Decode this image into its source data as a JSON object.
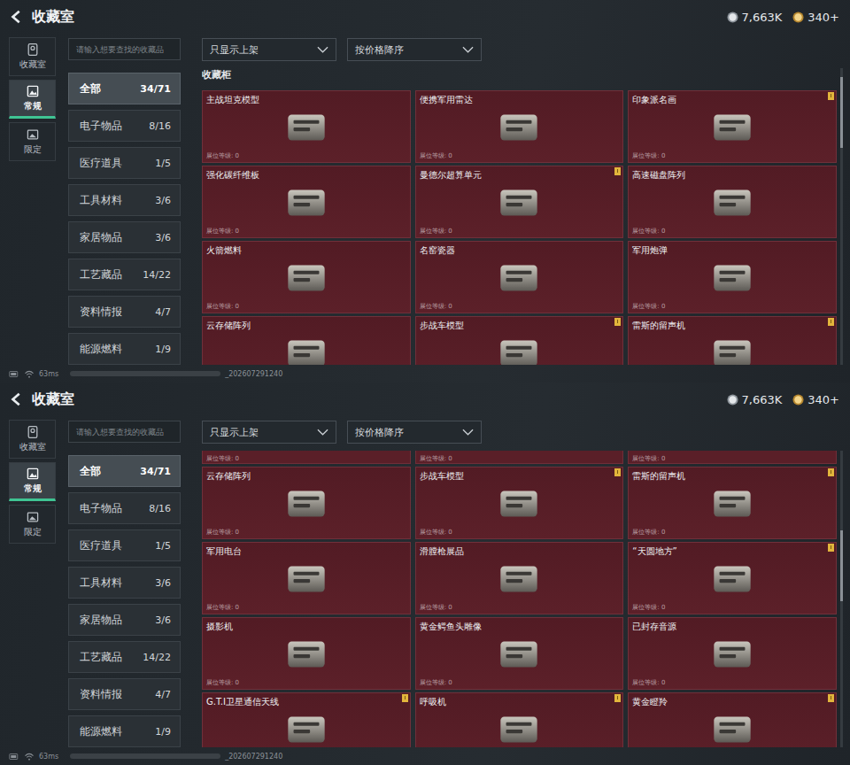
{
  "screens": [
    {
      "title": "收藏室",
      "currency": [
        {
          "amount": "7,663K",
          "kind": "silver"
        },
        {
          "amount": "340+",
          "kind": "gold"
        }
      ],
      "rail": [
        {
          "label": "收藏室",
          "selected": false
        },
        {
          "label": "常规",
          "selected": true
        },
        {
          "label": "限定",
          "selected": false
        }
      ],
      "search": {
        "placeholder": "请输入想要查找的收藏品"
      },
      "categories": [
        {
          "name": "全部",
          "count": "34/71",
          "selected": true
        },
        {
          "name": "电子物品",
          "count": "8/16",
          "selected": false
        },
        {
          "name": "医疗道具",
          "count": "1/5",
          "selected": false
        },
        {
          "name": "工具材料",
          "count": "3/6",
          "selected": false
        },
        {
          "name": "家居物品",
          "count": "3/6",
          "selected": false
        },
        {
          "name": "工艺藏品",
          "count": "14/22",
          "selected": false
        },
        {
          "name": "资料情报",
          "count": "4/7",
          "selected": false
        },
        {
          "name": "能源燃料",
          "count": "1/9",
          "selected": false
        }
      ],
      "filters": [
        {
          "label": "只显示上架"
        },
        {
          "label": "按价格降序"
        }
      ],
      "section_title": "收藏柜",
      "partial_row": [],
      "cards": [
        {
          "name": "主战坦克模型",
          "level_text": "展位等级: 0",
          "badge": false
        },
        {
          "name": "便携军用雷达",
          "level_text": "展位等级: 0",
          "badge": false
        },
        {
          "name": "印象派名画",
          "level_text": "展位等级: 0",
          "badge": true
        },
        {
          "name": "强化碳纤维板",
          "level_text": "展位等级: 0",
          "badge": false
        },
        {
          "name": "曼德尔超算单元",
          "level_text": "展位等级: 0",
          "badge": true
        },
        {
          "name": "高速磁盘阵列",
          "level_text": "展位等级: 0",
          "badge": false
        },
        {
          "name": "火箭燃料",
          "level_text": "展位等级: 0",
          "badge": false
        },
        {
          "name": "名窑瓷器",
          "level_text": "展位等级: 0",
          "badge": false
        },
        {
          "name": "军用炮弹",
          "level_text": "展位等级: 0",
          "badge": false
        },
        {
          "name": "云存储阵列",
          "badge": false
        },
        {
          "name": "步战车模型",
          "badge": true
        },
        {
          "name": "雷斯的留声机",
          "badge": true
        }
      ],
      "status": {
        "ping": "63ms",
        "build": "_202607291240"
      }
    },
    {
      "title": "收藏室",
      "currency": [
        {
          "amount": "7,663K",
          "kind": "silver"
        },
        {
          "amount": "340+",
          "kind": "gold"
        }
      ],
      "rail": [
        {
          "label": "收藏室",
          "selected": false
        },
        {
          "label": "常规",
          "selected": true
        },
        {
          "label": "限定",
          "selected": false
        }
      ],
      "search": {
        "placeholder": "请输入想要查找的收藏品"
      },
      "categories": [
        {
          "name": "全部",
          "count": "34/71",
          "selected": true
        },
        {
          "name": "电子物品",
          "count": "8/16",
          "selected": false
        },
        {
          "name": "医疗道具",
          "count": "1/5",
          "selected": false
        },
        {
          "name": "工具材料",
          "count": "3/6",
          "selected": false
        },
        {
          "name": "家居物品",
          "count": "3/6",
          "selected": false
        },
        {
          "name": "工艺藏品",
          "count": "14/22",
          "selected": false
        },
        {
          "name": "资料情报",
          "count": "4/7",
          "selected": false
        },
        {
          "name": "能源燃料",
          "count": "1/9",
          "selected": false
        }
      ],
      "filters": [
        {
          "label": "只显示上架"
        },
        {
          "label": "按价格降序"
        }
      ],
      "partial_row": [
        {
          "level_text": "展位等级: 0"
        },
        {
          "level_text": "展位等级: 0"
        },
        {
          "level_text": "展位等级: 0"
        }
      ],
      "cards": [
        {
          "name": "云存储阵列",
          "level_text": "展位等级: 0",
          "badge": false
        },
        {
          "name": "步战车模型",
          "level_text": "展位等级: 0",
          "badge": true
        },
        {
          "name": "雷斯的留声机",
          "level_text": "展位等级: 0",
          "badge": true
        },
        {
          "name": "军用电台",
          "level_text": "展位等级: 0",
          "badge": false
        },
        {
          "name": "滑膛枪展品",
          "level_text": "展位等级: 0",
          "badge": false
        },
        {
          "name": "“天圆地方”",
          "level_text": "展位等级: 0",
          "badge": true
        },
        {
          "name": "摄影机",
          "level_text": "展位等级: 0",
          "badge": false
        },
        {
          "name": "黄金鳄鱼头雕像",
          "level_text": "展位等级: 0",
          "badge": false
        },
        {
          "name": "已封存音源",
          "level_text": "展位等级: 0",
          "badge": false
        },
        {
          "name": "G.T.I卫星通信天线",
          "badge": true
        },
        {
          "name": "呼吸机",
          "badge": true
        },
        {
          "name": "黄金瞪羚",
          "badge": true
        }
      ],
      "status": {
        "ping": "63ms",
        "build": "_202607291240"
      }
    }
  ]
}
